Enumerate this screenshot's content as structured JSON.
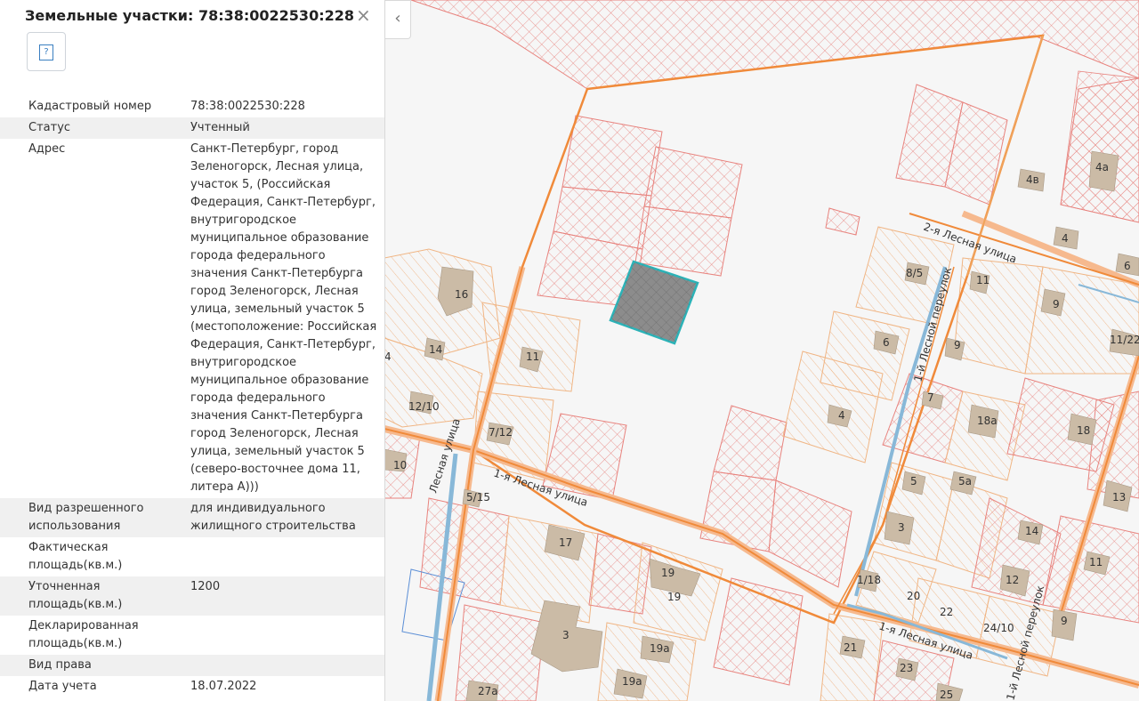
{
  "panel": {
    "title": "Земельные участки: 78:38:0022530:228",
    "close_symbol": "×",
    "info_button_icon": "help-icon",
    "info_button_symbol": "?",
    "properties": [
      {
        "label": "Кадастровый номер",
        "value": "78:38:0022530:228"
      },
      {
        "label": "Статус",
        "value": "Учтенный"
      },
      {
        "label": "Адрес",
        "value": "Санкт-Петербург, город Зеленогорск, Лесная улица, участок 5, (Российская Федерация, Санкт-Петербург, внутригородское муниципальное образование города федерального значения Санкт-Петербурга город Зеленогорск, Лесная улица, земельный участок 5 (местоположение: Российская Федерация, Санкт-Петербург, внутригородское муниципальное образование города федерального значения Санкт-Петербурга город Зеленогорск, Лесная улица, земельный участок 5 (северо-восточнее дома 11, литера А)))"
      },
      {
        "label": "Вид разрешенного использования",
        "value": "для индивидуального жилищного строительства"
      },
      {
        "label": "Фактическая площадь(кв.м.)",
        "value": ""
      },
      {
        "label": "Уточненная площадь(кв.м.)",
        "value": "1200"
      },
      {
        "label": "Декларированная площадь(кв.м.)",
        "value": ""
      },
      {
        "label": "Вид права",
        "value": ""
      },
      {
        "label": "Дата учета",
        "value": "18.07.2022"
      }
    ]
  },
  "collapse_symbol": "‹",
  "map": {
    "colors": {
      "parcel": "#e8837e",
      "building_outline": "#f0b584",
      "road": "#f08a3a",
      "road_fill": "#f6b98e",
      "water": "#88b8d8",
      "selected": "#2bb3b8",
      "selected_fill": "#8a8a8a",
      "house": "#cbbba6"
    },
    "streets": {
      "s1": "2-я Лесная улица",
      "s2": "1-я Лесная улица",
      "s3": "Лесная улица",
      "s4": "1-й Лесной переулок",
      "s5": "1-я Лесная улица",
      "s6": "1-й Лесной переулок"
    },
    "parcel_labels": {
      "p16": "16",
      "p14": "14",
      "p4w": "4",
      "p1210": "12/10",
      "p11a": "11",
      "p712": "7/12",
      "p10": "10",
      "p515": "5/15",
      "p17": "17",
      "p19": "19",
      "p19b": "19",
      "p3": "3",
      "p19a": "19а",
      "p19a2": "19а",
      "p27a": "27а",
      "p4v": "4в",
      "p4a": "4а",
      "p4": "4",
      "p6": "6",
      "p85": "8/5",
      "p11b": "11",
      "p9": "9",
      "p1122": "11/22",
      "p6b": "6",
      "p9b": "9",
      "p7": "7",
      "p18a": "18а",
      "p18": "18",
      "p4b": "4",
      "p5": "5",
      "p5a": "5а",
      "p13": "13",
      "p3b": "3",
      "p14b": "14",
      "p11c": "11",
      "p12": "12",
      "p118": "1/18",
      "p20": "20",
      "p22": "22",
      "p2410": "24/10",
      "p9c": "9",
      "p21": "21",
      "p23": "23",
      "p25": "25"
    }
  }
}
